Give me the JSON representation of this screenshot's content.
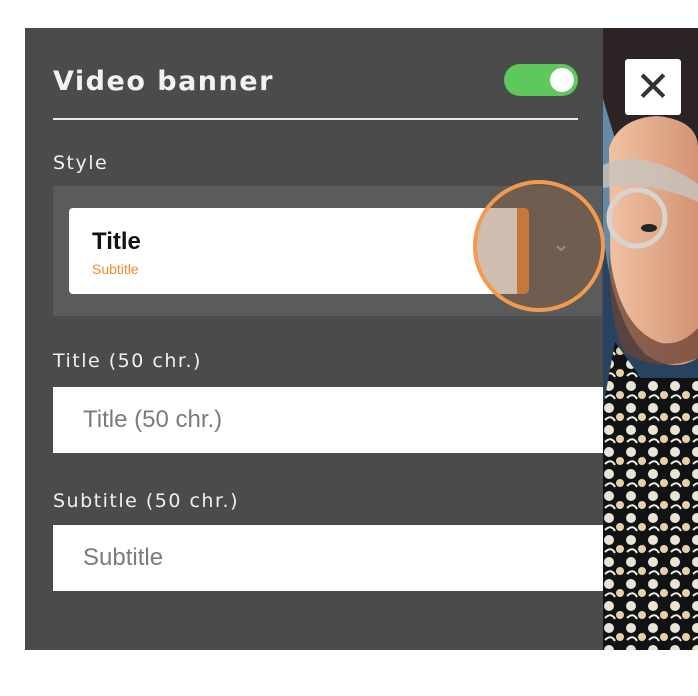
{
  "panel": {
    "title": "Video banner",
    "toggle": {
      "state": "on",
      "color": "#5ec85c"
    }
  },
  "style_section": {
    "label": "Style",
    "selected": {
      "title": "Title",
      "subtitle": "Subtitle"
    },
    "accent_color": "#ee8933",
    "chevron_icon": "chevron-down-icon"
  },
  "title_field": {
    "label": "Title (50 chr.)",
    "value": "",
    "placeholder": "Title (50 chr.)"
  },
  "subtitle_field": {
    "label": "Subtitle (50 chr.)",
    "value": "",
    "placeholder": "Subtitle"
  },
  "video": {
    "close_icon": "close-icon",
    "close_symbol": "✕"
  }
}
